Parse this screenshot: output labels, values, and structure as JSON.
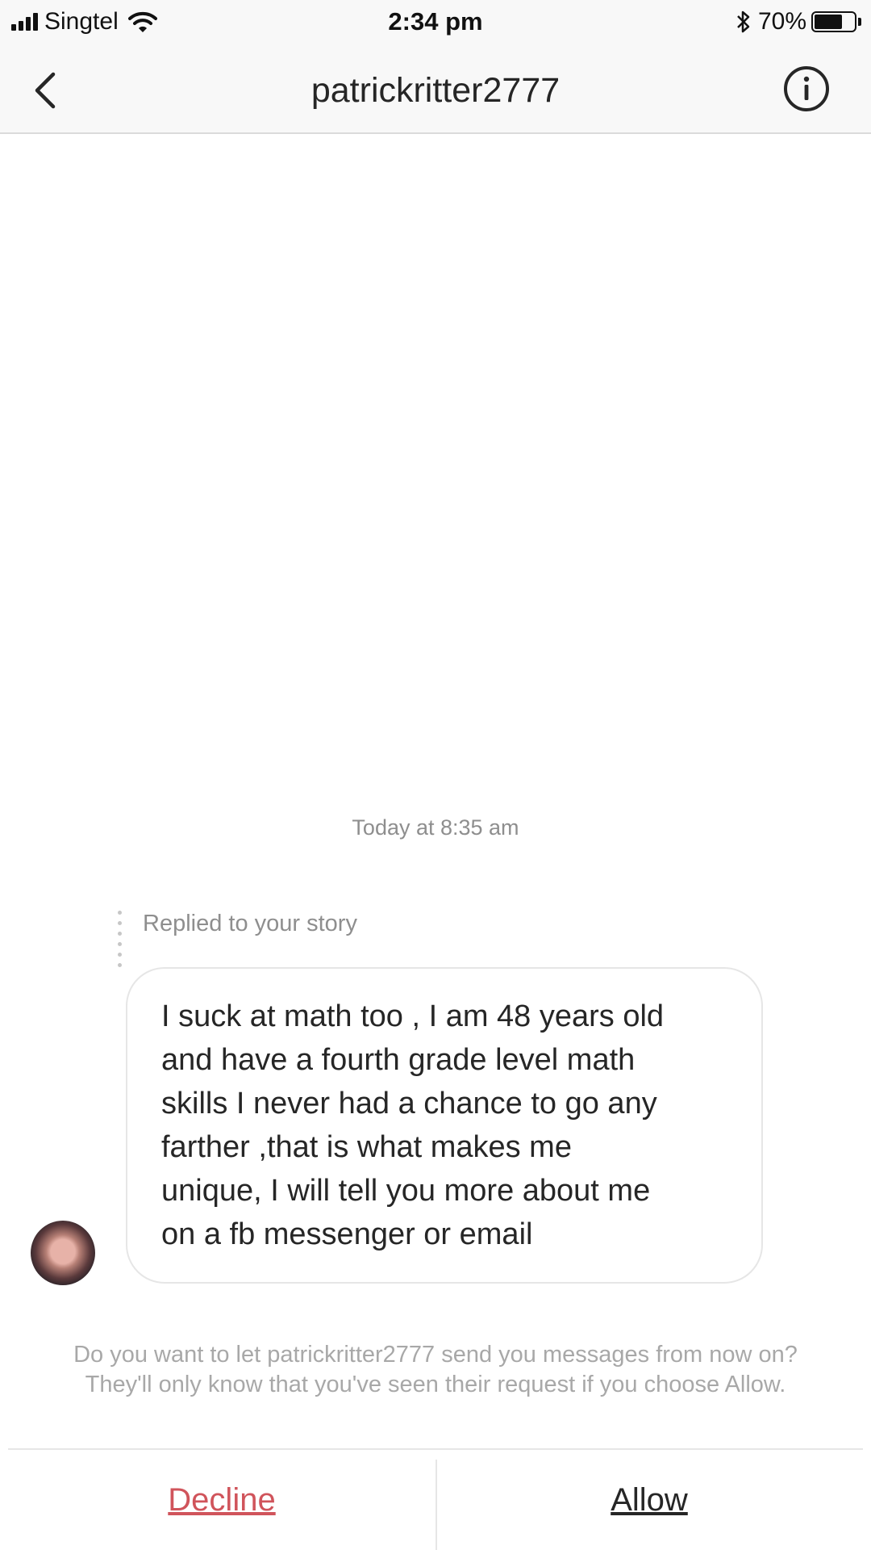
{
  "status_bar": {
    "carrier": "Singtel",
    "time": "2:34 pm",
    "battery_percent": "70%",
    "battery_level": 0.7,
    "signal_bars": 4,
    "icons": [
      "signal-icon",
      "wifi-icon",
      "bluetooth-icon",
      "battery-icon"
    ]
  },
  "nav": {
    "title": "patrickritter2777",
    "back_icon": "chevron-left-icon",
    "info_icon": "info-circle-icon"
  },
  "thread": {
    "timestamp": "Today at 8:35 am",
    "reply_label": "Replied to your story",
    "message_lines": [
      "I suck at math too , I am 48 years old",
      "and have a fourth grade level math",
      "skills I never had a chance to go any",
      "farther ,that is what makes me",
      "unique, I will tell you more about me",
      "on a fb messenger or email"
    ]
  },
  "request": {
    "prompt_lines": [
      "Do you want to let patrickritter2777 send you messages from now on?",
      "They'll only know that you've seen their request if you choose Allow."
    ],
    "decline_label": "Decline",
    "allow_label": "Allow"
  },
  "colors": {
    "decline": "#d0545b",
    "secondary_text": "#8e8e8e",
    "border": "#e6e6e6"
  }
}
